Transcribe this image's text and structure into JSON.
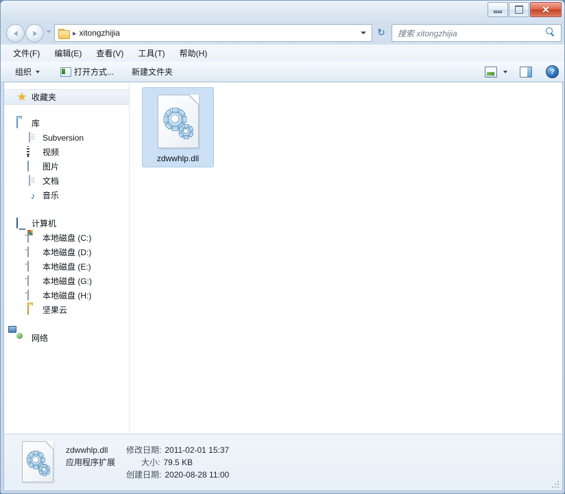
{
  "window": {
    "titlebar": {
      "minimize_label": "—",
      "maximize_label": "",
      "close_label": "✕"
    }
  },
  "address": {
    "back_tooltip": "后退",
    "forward_tooltip": "前进",
    "separator": "▸",
    "path_segment": "xitongzhijia",
    "refresh_label": "↻"
  },
  "search": {
    "placeholder": "搜索 xitongzhijia"
  },
  "menubar": {
    "items": [
      {
        "label": "文件(F)",
        "name": "menu-file"
      },
      {
        "label": "编辑(E)",
        "name": "menu-edit"
      },
      {
        "label": "查看(V)",
        "name": "menu-view"
      },
      {
        "label": "工具(T)",
        "name": "menu-tools"
      },
      {
        "label": "帮助(H)",
        "name": "menu-help"
      }
    ]
  },
  "toolbar": {
    "organize_label": "组织",
    "open_with_label": "打开方式...",
    "new_folder_label": "新建文件夹",
    "help_label": "?"
  },
  "sidebar": {
    "groups": [
      {
        "root": {
          "label": "收藏夹",
          "icon": "star-icon",
          "selected": true
        },
        "children": []
      },
      {
        "root": {
          "label": "库",
          "icon": "library-icon",
          "selected": false
        },
        "children": [
          {
            "label": "Subversion",
            "icon": "document-icon"
          },
          {
            "label": "视频",
            "icon": "video-icon"
          },
          {
            "label": "图片",
            "icon": "picture-icon"
          },
          {
            "label": "文档",
            "icon": "document-icon"
          },
          {
            "label": "音乐",
            "icon": "music-icon"
          }
        ]
      },
      {
        "root": {
          "label": "计算机",
          "icon": "computer-icon",
          "selected": false
        },
        "children": [
          {
            "label": "本地磁盘 (C:)",
            "icon": "system-drive-icon"
          },
          {
            "label": "本地磁盘 (D:)",
            "icon": "drive-icon"
          },
          {
            "label": "本地磁盘 (E:)",
            "icon": "drive-icon"
          },
          {
            "label": "本地磁盘 (G:)",
            "icon": "drive-icon"
          },
          {
            "label": "本地磁盘 (H:)",
            "icon": "drive-icon"
          },
          {
            "label": "坚果云",
            "icon": "folder-icon"
          }
        ]
      },
      {
        "root": {
          "label": "网络",
          "icon": "network-icon",
          "selected": false
        },
        "children": []
      }
    ]
  },
  "content": {
    "files": [
      {
        "name": "zdwwhlp.dll",
        "icon": "dll-gears-icon",
        "selected": true
      }
    ]
  },
  "statusbar": {
    "file_name": "zdwwhlp.dll",
    "file_type": "应用程序扩展",
    "modified_key": "修改日期:",
    "modified_value": "2011-02-01 15:37",
    "size_key": "大小:",
    "size_value": "79.5 KB",
    "created_key": "创建日期:",
    "created_value": "2020-08-28 11:00"
  },
  "colors": {
    "accent": "#2a6fa8",
    "selection": "#cbe0f5",
    "selection_border": "#aecbe8",
    "frame": "#cfdcec",
    "close_button": "#c4442a",
    "folder_gold": "#f2c75c"
  }
}
